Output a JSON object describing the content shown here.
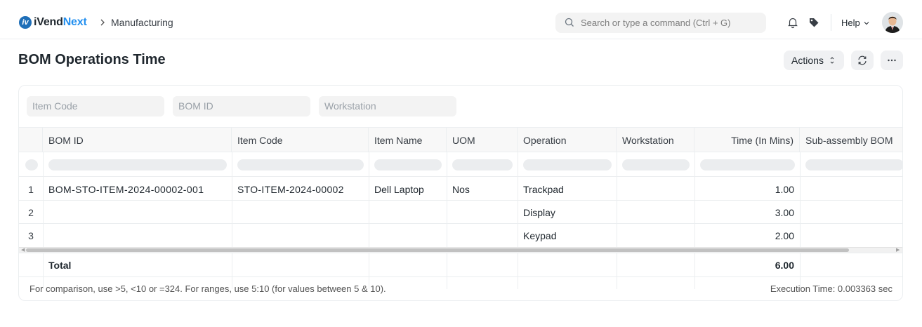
{
  "app": {
    "brand_prefix": "iVend",
    "brand_suffix": "Next",
    "breadcrumb": "Manufacturing"
  },
  "navbar": {
    "search_placeholder": "Search or type a command (Ctrl + G)",
    "help_label": "Help"
  },
  "page": {
    "title": "BOM Operations Time",
    "actions_label": "Actions"
  },
  "filters": {
    "item_code": "Item Code",
    "bom_id": "BOM ID",
    "workstation": "Workstation"
  },
  "table": {
    "columns": [
      "BOM ID",
      "Item Code",
      "Item Name",
      "UOM",
      "Operation",
      "Workstation",
      "Time (In Mins)",
      "Sub-assembly BOM"
    ],
    "rows": [
      {
        "index": "1",
        "bom_id": "BOM-STO-ITEM-2024-00002-001",
        "item_code": "STO-ITEM-2024-00002",
        "item_name": "Dell Laptop",
        "uom": "Nos",
        "operation": "Trackpad",
        "workstation": "",
        "time": "1.00",
        "sub_bom": ""
      },
      {
        "index": "2",
        "bom_id": "",
        "item_code": "",
        "item_name": "",
        "uom": "",
        "operation": "Display",
        "workstation": "",
        "time": "3.00",
        "sub_bom": ""
      },
      {
        "index": "3",
        "bom_id": "",
        "item_code": "",
        "item_name": "",
        "uom": "",
        "operation": "Keypad",
        "workstation": "",
        "time": "2.00",
        "sub_bom": ""
      }
    ],
    "total_label": "Total",
    "total_time": "6.00"
  },
  "footer": {
    "hint": "For comparison, use >5, <10 or =324. For ranges, use 5:10 (for values between 5 & 10).",
    "execution_time": "Execution Time: 0.003363 sec"
  },
  "colors": {
    "brand_blue": "#2490ef",
    "text": "#1f272e",
    "border": "#ebeef0"
  }
}
